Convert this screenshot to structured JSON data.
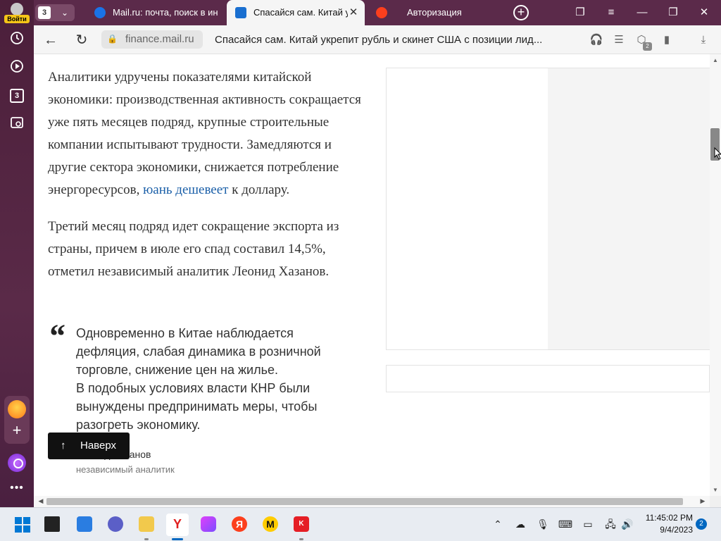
{
  "sidebar": {
    "login_label": "Войти",
    "tabs_count": "3"
  },
  "tabs": {
    "counter": "3",
    "items": [
      {
        "title": "Mail.ru: почта, поиск в ин",
        "icon": "mail-ru-icon"
      },
      {
        "title": "Спасайся сам. Китай ук",
        "icon": "mail-finance-icon",
        "active": true
      },
      {
        "title": "Авторизация",
        "icon": "yandex-icon"
      }
    ]
  },
  "addressbar": {
    "domain": "finance.mail.ru",
    "page_title": "Спасайся сам. Китай укрепит рубль и скинет США с позиции лид...",
    "extensions_badge": "2"
  },
  "article": {
    "paragraph1_text": "Аналитики удручены показателями китайской экономики: производственная активность сокращается уже пять месяцев подряд, крупные строительные компании испытывают трудности. Замедляются и другие сектора экономики, снижается потребление энергоресурсов, ",
    "paragraph1_link": "юань дешевеет",
    "paragraph1_tail": " к доллару.",
    "paragraph2": "Третий месяц подряд идет сокращение экспорта из страны, причем в июле его спад составил 14,5%, отметил независимый аналитик Леонид Хазанов.",
    "quote_mark": "“",
    "quote_line1": "Одновременно в Китае наблюдается дефляция, слабая динамика в розничной торговле, снижение цен на жилье.",
    "quote_line2": "В подобных условиях власти КНР были вынуждены предпринимать меры, чтобы разогреть экономику.",
    "quote_author": "Леонид Хазанов",
    "quote_author_role": "независимый аналитик"
  },
  "back_to_top": {
    "label": "Наверх"
  },
  "taskbar": {
    "time": "11:45:02 PM",
    "date": "9/4/2023",
    "notifications": "2"
  },
  "colors": {
    "sidebar_bg": "#5b2a4a",
    "link": "#1a5fa8",
    "taskbar_accent": "#0067c0"
  }
}
